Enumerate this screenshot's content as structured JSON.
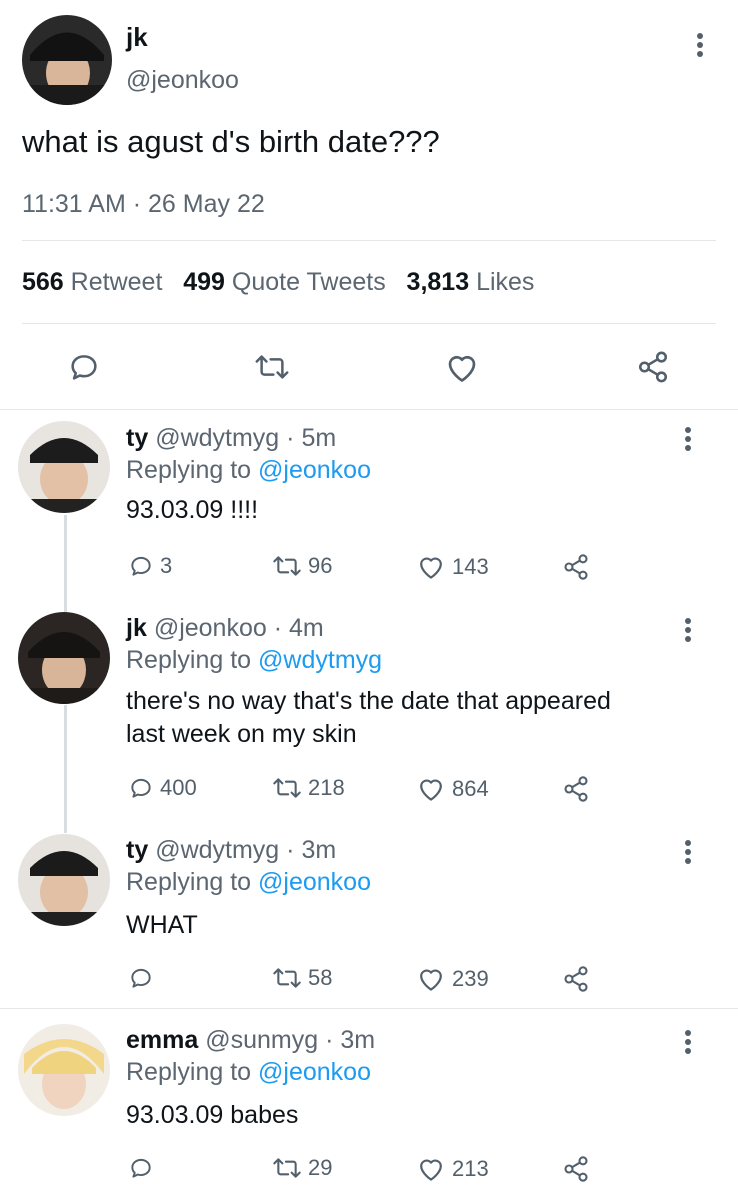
{
  "main_tweet": {
    "name": "jk",
    "handle": "@jeonkoo",
    "text": "what is agust d's birth date???",
    "time": "11:31 AM",
    "date": "26 May 22",
    "sep": "·",
    "stats": {
      "retweets_count": "566",
      "retweets_label": "Retweet",
      "quotes_count": "499",
      "quotes_label": "Quote Tweets",
      "likes_count": "3,813",
      "likes_label": "Likes"
    }
  },
  "replies": [
    {
      "name": "ty",
      "handle": "@wdytmyg",
      "time": "5m",
      "replying_label": "Replying to",
      "replying_to": "@jeonkoo",
      "text": "93.03.09 !!!!",
      "reply_count": "3",
      "retweet_count": "96",
      "like_count": "143"
    },
    {
      "name": "jk",
      "handle": "@jeonkoo",
      "time": "4m",
      "replying_label": "Replying to",
      "replying_to": "@wdytmyg",
      "text_line1": "there's no way that's the date that appeared",
      "text_line2": "last week on my skin",
      "reply_count": "400",
      "retweet_count": "218",
      "like_count": "864"
    },
    {
      "name": "ty",
      "handle": "@wdytmyg",
      "time": "3m",
      "replying_label": "Replying to",
      "replying_to": "@jeonkoo",
      "text": "WHAT",
      "reply_count": "",
      "retweet_count": "58",
      "like_count": "239"
    },
    {
      "name": "emma",
      "handle": "@sunmyg",
      "time": "3m",
      "replying_label": "Replying to",
      "replying_to": "@jeonkoo",
      "text": "93.03.09 babes",
      "reply_count": "",
      "retweet_count": "29",
      "like_count": "213"
    }
  ],
  "colors": {
    "link": "#1d9bf0",
    "text": "#0f1419",
    "muted": "#5b6671",
    "divider": "#e3e7ea"
  },
  "icons": [
    "reply-icon",
    "retweet-icon",
    "like-icon",
    "share-icon",
    "more-icon"
  ]
}
